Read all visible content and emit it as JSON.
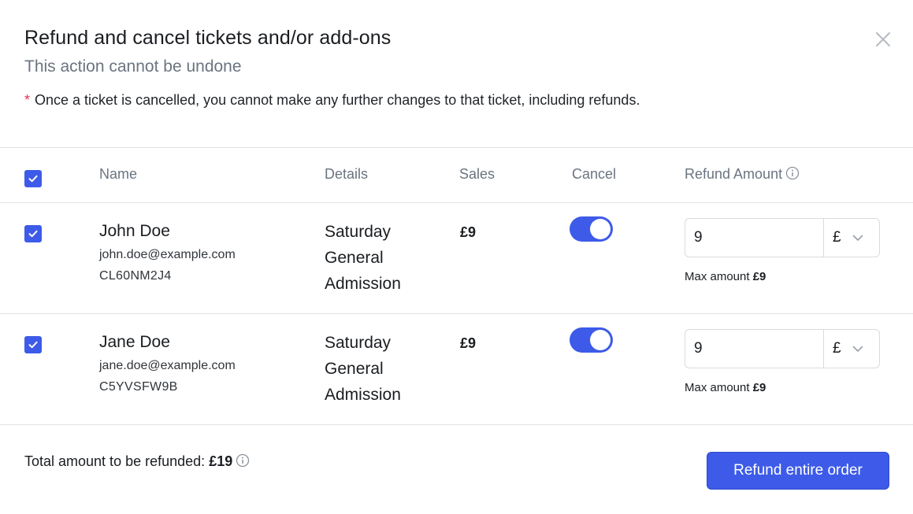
{
  "dialog": {
    "title": "Refund and cancel tickets and/or add-ons",
    "subtitle": "This action cannot be undone",
    "note_star": "*",
    "note": "Once a ticket is cancelled, you cannot make any further changes to that ticket, including refunds."
  },
  "table": {
    "headers": {
      "name": "Name",
      "details": "Details",
      "sales": "Sales",
      "cancel": "Cancel",
      "refund_amount": "Refund Amount"
    },
    "select_all_checked": true,
    "rows": [
      {
        "checked": true,
        "name": "John Doe",
        "email": "john.doe@example.com",
        "code": "CL60NM2J4",
        "details_line1": "Saturday",
        "details_line2": "General",
        "details_line3": "Admission",
        "sales": "£9",
        "cancel_on": true,
        "refund_value": "9",
        "currency": "£",
        "max_label": "Max amount",
        "max_value": "£9"
      },
      {
        "checked": true,
        "name": "Jane Doe",
        "email": "jane.doe@example.com",
        "code": "C5YVSFW9B",
        "details_line1": "Saturday",
        "details_line2": "General",
        "details_line3": "Admission",
        "sales": "£9",
        "cancel_on": true,
        "refund_value": "9",
        "currency": "£",
        "max_label": "Max amount",
        "max_value": "£9"
      }
    ]
  },
  "footer": {
    "total_label": "Total amount to be refunded:",
    "total_value": "£19",
    "refund_button": "Refund entire order"
  },
  "colors": {
    "accent": "#3d5be8",
    "required_star": "#e0364f",
    "muted_text": "#6b7481"
  },
  "icons": {
    "close": "close-icon",
    "info": "info-icon",
    "check": "checkmark-icon",
    "chevron": "chevron-down-icon"
  }
}
